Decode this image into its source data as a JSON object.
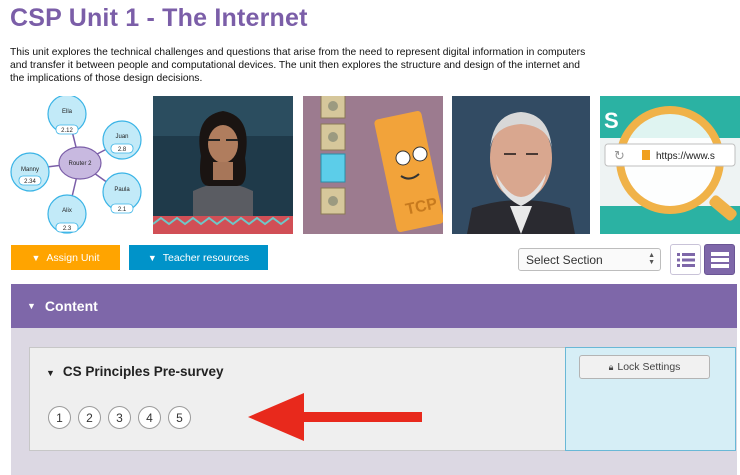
{
  "unit": {
    "title": "CSP Unit 1 - The Internet",
    "description": "This unit explores the technical challenges and questions that arise from the need to represent digital information in computers and transfer it between people and computational devices. The unit then explores the structure and design of the internet and the implications of those design decisions."
  },
  "network_diagram": {
    "router_label": "Router 2",
    "nodes": [
      {
        "name": "Ella",
        "value": "2.12"
      },
      {
        "name": "Juan",
        "value": "2.8"
      },
      {
        "name": "Manny",
        "value": "2.34"
      },
      {
        "name": "Paula",
        "value": "2.1"
      },
      {
        "name": "Alix",
        "value": "2.3"
      }
    ]
  },
  "illustration": {
    "tcp_label": "TCP"
  },
  "browser_image": {
    "url_text": "https://www.s",
    "banner_text": "S"
  },
  "buttons": {
    "assign_unit": "Assign Unit",
    "teacher_resources": "Teacher resources"
  },
  "section_select": {
    "selected": "Select Section"
  },
  "content": {
    "header": "Content"
  },
  "lesson": {
    "title": "CS Principles Pre-survey",
    "bubbles": [
      "1",
      "2",
      "3",
      "4",
      "5"
    ]
  },
  "lock": {
    "label": "Lock Settings"
  },
  "colors": {
    "purple": "#7b5ea8",
    "orange": "#ffa400",
    "blue": "#0093c9",
    "lock_panel": "#d6eef6",
    "arrow_red": "#e8291c"
  }
}
